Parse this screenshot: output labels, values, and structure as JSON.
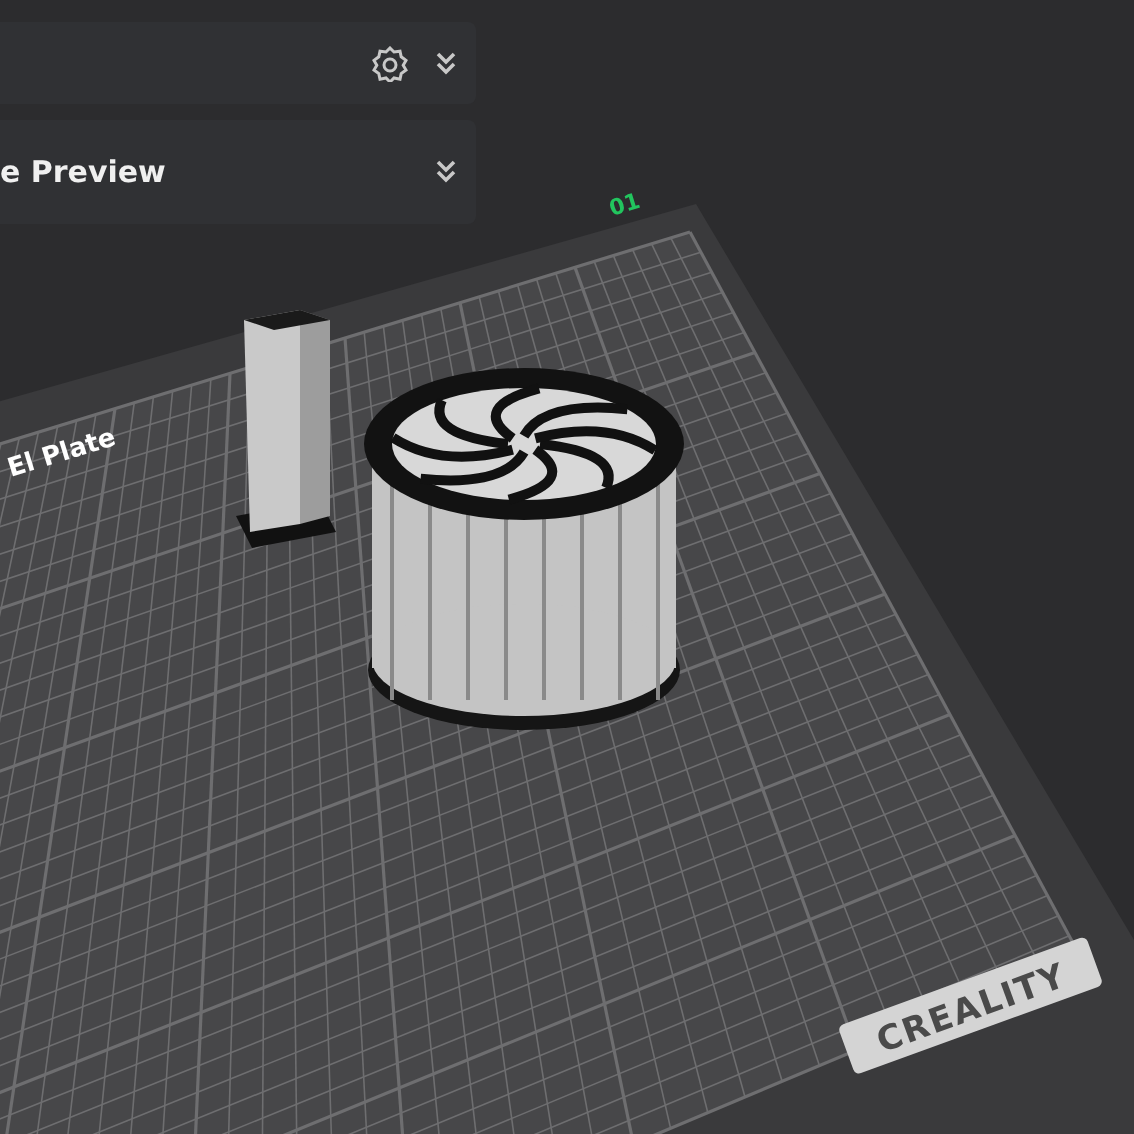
{
  "panels": [
    {
      "kind": "settings"
    },
    {
      "kind": "preview",
      "title": "e Preview"
    }
  ],
  "plate": {
    "name": "El Plate",
    "number": "01",
    "brand": "CREALITY"
  }
}
